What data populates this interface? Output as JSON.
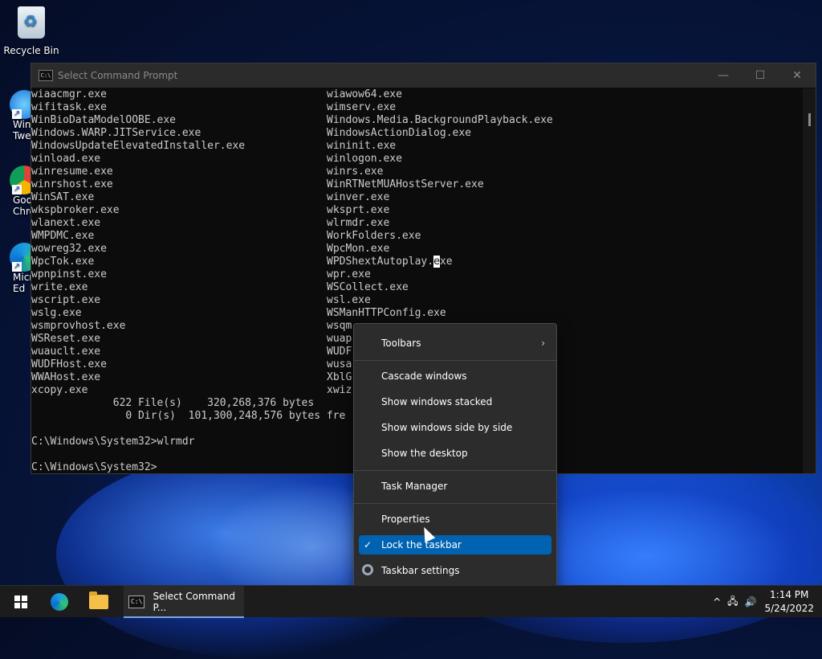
{
  "desktop": {
    "recycle_bin": "Recycle Bin",
    "partial_icons": [
      {
        "label": "Win\nTwe",
        "icon": "windows-tweaker-icon"
      },
      {
        "label": "Goo\nChro",
        "icon": "chrome-icon"
      },
      {
        "label": "Micr\nEd",
        "icon": "edge-icon"
      }
    ]
  },
  "window": {
    "title": "Select Command Prompt",
    "controls": {
      "minimize": "—",
      "maximize": "☐",
      "close": "✕"
    }
  },
  "console": {
    "rows": [
      [
        "wiaacmgr.exe",
        "wiawow64.exe"
      ],
      [
        "wifitask.exe",
        "wimserv.exe"
      ],
      [
        "WinBioDataModelOOBE.exe",
        "Windows.Media.BackgroundPlayback.exe"
      ],
      [
        "Windows.WARP.JITService.exe",
        "WindowsActionDialog.exe"
      ],
      [
        "WindowsUpdateElevatedInstaller.exe",
        "wininit.exe"
      ],
      [
        "winload.exe",
        "winlogon.exe"
      ],
      [
        "winresume.exe",
        "winrs.exe"
      ],
      [
        "winrshost.exe",
        "WinRTNetMUAHostServer.exe"
      ],
      [
        "WinSAT.exe",
        "winver.exe"
      ],
      [
        "wkspbroker.exe",
        "wksprt.exe"
      ],
      [
        "wlanext.exe",
        "wlrmdr.exe"
      ],
      [
        "WMPDMC.exe",
        "WorkFolders.exe"
      ],
      [
        "wowreg32.exe",
        "WpcMon.exe"
      ],
      [
        "WpcTok.exe",
        "WPDShextAutoplay.exe"
      ],
      [
        "wpnpinst.exe",
        "wpr.exe"
      ],
      [
        "write.exe",
        "WSCollect.exe"
      ],
      [
        "wscript.exe",
        "wsl.exe"
      ],
      [
        "wslg.exe",
        "WSManHTTPConfig.exe"
      ],
      [
        "wsmprovhost.exe",
        "wsqm"
      ],
      [
        "WSReset.exe",
        "wuap"
      ],
      [
        "wuauclt.exe",
        "WUDF"
      ],
      [
        "WUDFHost.exe",
        "wusa"
      ],
      [
        "WWAHost.exe",
        "XblG"
      ],
      [
        "xcopy.exe",
        "xwiz"
      ]
    ],
    "summary1": "             622 File(s)    320,268,376 bytes",
    "summary2": "               0 Dir(s)  101,300,248,576 bytes fre",
    "blank": "",
    "cmd1": "C:\\Windows\\System32>wlrmdr",
    "blank2": "",
    "prompt": "C:\\Windows\\System32>",
    "selection_highlight_row": 13,
    "selection_highlight_text_before": "WPDShextAutoplay.",
    "selection_highlight_char": "e",
    "selection_highlight_text_after": "xe"
  },
  "context_menu": {
    "toolbars": "Toolbars",
    "cascade": "Cascade windows",
    "stacked": "Show windows stacked",
    "side_by_side": "Show windows side by side",
    "show_desktop": "Show the desktop",
    "task_manager": "Task Manager",
    "properties": "Properties",
    "lock_taskbar": "Lock the taskbar",
    "taskbar_settings": "Taskbar settings",
    "lock_checked": true
  },
  "taskbar": {
    "active_app": "Select Command P...",
    "tray": {
      "chevron": "^",
      "network": "🖧",
      "volume": "🔊"
    },
    "time": "1:14 PM",
    "date": "5/24/2022"
  },
  "colors": {
    "console_bg": "#0c0c0c",
    "console_fg": "#cccccc",
    "menu_bg": "#2c2c2c",
    "menu_highlight": "#0063b1",
    "taskbar_bg": "#1c1c1c"
  }
}
